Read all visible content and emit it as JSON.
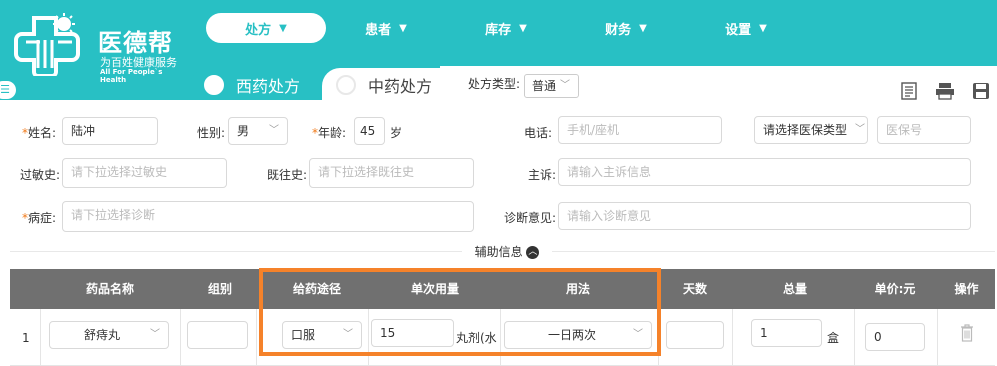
{
  "brand": {
    "name": "医德帮",
    "slogan_cn": "为百姓健康服务",
    "slogan_en": "All For People`s Health",
    "color": "#28c0c4"
  },
  "nav": [
    {
      "label": "处方",
      "active": true
    },
    {
      "label": "患者",
      "active": false
    },
    {
      "label": "库存",
      "active": false
    },
    {
      "label": "财务",
      "active": false
    },
    {
      "label": "设置",
      "active": false
    }
  ],
  "tabs": [
    {
      "label": "西药处方",
      "active": true
    },
    {
      "label": "中药处方",
      "active": false
    }
  ],
  "rx_type": {
    "label": "处方类型:",
    "value": "普通"
  },
  "toolbar_icons": [
    "prescription-icon",
    "print-icon",
    "save-icon"
  ],
  "form": {
    "name": {
      "label": "姓名:",
      "value": "陆冲"
    },
    "gender": {
      "label": "性别:",
      "value": "男"
    },
    "age": {
      "label": "年龄:",
      "value": "45",
      "unit": "岁"
    },
    "phone": {
      "label": "电话:",
      "placeholder": "手机/座机"
    },
    "insurance_type": {
      "value": "请选择医保类型"
    },
    "insurance_no": {
      "placeholder": "医保号"
    },
    "allergy": {
      "label": "过敏史:",
      "placeholder": "请下拉选择过敏史"
    },
    "history": {
      "label": "既往史:",
      "placeholder": "请下拉选择既往史"
    },
    "complaint": {
      "label": "主诉:",
      "placeholder": "请输入主诉信息"
    },
    "diagnosis": {
      "label": "病症:",
      "placeholder": "请下拉选择诊断"
    },
    "opinion": {
      "label": "诊断意见:",
      "placeholder": "请输入诊断意见"
    }
  },
  "aux_label": "辅助信息",
  "table": {
    "headers": [
      "药品名称",
      "组别",
      "给药途径",
      "单次用量",
      "用法",
      "天数",
      "总量",
      "单价:元",
      "操作"
    ],
    "rows": [
      {
        "index": "1",
        "drug": "舒痔丸",
        "group": "",
        "route": "口服",
        "dose": "15",
        "dose_unit": "丸剂(水",
        "usage": "一日两次",
        "days": "",
        "total": "1",
        "total_unit": "盒",
        "price": "0"
      }
    ]
  }
}
